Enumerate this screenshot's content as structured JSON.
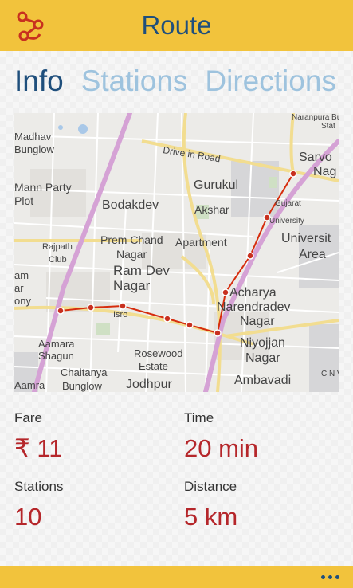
{
  "header": {
    "title": "Route",
    "logo_icon": "route-icon"
  },
  "tabs": [
    {
      "label": "Info",
      "active": true
    },
    {
      "label": "Stations",
      "active": false
    },
    {
      "label": "Directions",
      "active": false
    }
  ],
  "map": {
    "labels": {
      "naranpura": "Naranpura Bus",
      "stat": "Stat",
      "madhav1": "Madhav",
      "madhav2": "Bunglow",
      "mann1": "Mann Party",
      "mann2": "Plot",
      "drive": "Drive in Road",
      "gurukul": "Gurukul",
      "sarvo1": "Sarvo",
      "sarvo2": "Nag",
      "bodakdev": "Bodakdev",
      "gujarat1": "Gujarat",
      "gujarat2": "University",
      "akshar1": "Akshar",
      "akshar2": "Apartment",
      "rajpath1": "Rajpath",
      "rajpath2": "Club",
      "premchand1": "Prem Chand",
      "premchand2": "Nagar",
      "university1": "Universit",
      "university2": "Area",
      "ramdev1": "Ram Dev",
      "ramdev2": "Nagar",
      "am": "am",
      "ar": "ar",
      "ony": "ony",
      "isro": "Isro",
      "acharya1": "Acharya",
      "acharya2": "Narendradev",
      "acharya3": "Nagar",
      "aamara1": "Aamara",
      "aamara2": "Shagun",
      "rosewood1": "Rosewood",
      "rosewood2": "Estate",
      "niyojjan1": "Niyojjan",
      "niyojjan2": "Nagar",
      "chaitanya1": "Chaitanya",
      "chaitanya2": "Bunglow",
      "jodhpur": "Jodhpur",
      "ambavadi": "Ambavadi",
      "cnvidy": "C N Vidy",
      "aamra": "Aamra"
    },
    "route_color": "#d62d0e",
    "stations": 10
  },
  "info": {
    "fare_label": "Fare",
    "fare_value": "₹ 11",
    "time_label": "Time",
    "time_value": "20 min",
    "stations_label": "Stations",
    "stations_value": "10",
    "distance_label": "Distance",
    "distance_value": "5 km"
  },
  "footer": {
    "more_icon": "more-icon"
  },
  "colors": {
    "accent": "#f2c33c",
    "title": "#1f4f7c",
    "tab_inactive": "#9ec3de",
    "value": "#b5262a"
  }
}
